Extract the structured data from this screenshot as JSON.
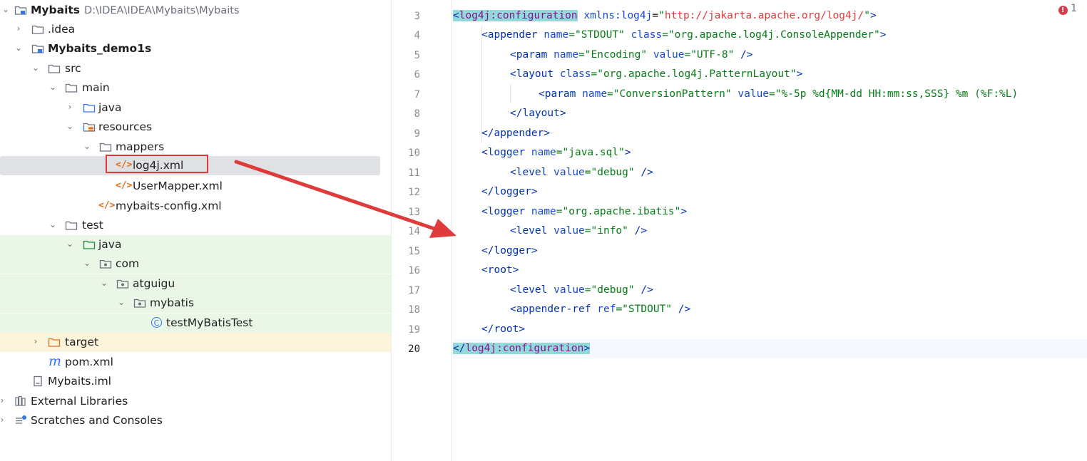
{
  "tree": {
    "project": {
      "name": "Mybaits",
      "path": "D:\\IDEA\\IDEA\\Mybaits\\Mybaits"
    },
    "idea": ".idea",
    "module": "Mybaits_demo1s",
    "src": "src",
    "main": "main",
    "main_java": "java",
    "resources": "resources",
    "mappers": "mappers",
    "log4j": "log4j.xml",
    "usermapper": "UserMapper.xml",
    "mybatis_config": "mybaits-config.xml",
    "test": "test",
    "test_java": "java",
    "com": "com",
    "atguigu": "atguigu",
    "mybatis": "mybatis",
    "test_class": "testMyBatisTest",
    "target": "target",
    "pom": "pom.xml",
    "iml": "Mybaits.iml",
    "external_libraries": "External Libraries",
    "scratches": "Scratches and Consoles"
  },
  "icons": {
    "code_glyph": "</>",
    "maven_glyph": "m",
    "class_glyph": "C",
    "chevron_right": "›",
    "chevron_down": "⌄"
  },
  "editor": {
    "problems_count": "1",
    "error_glyph": "!",
    "lines": [
      "3",
      "4",
      "5",
      "6",
      "7",
      "8",
      "9",
      "10",
      "11",
      "12",
      "13",
      "14",
      "15",
      "16",
      "17",
      "18",
      "19",
      "20"
    ],
    "code": {
      "l3": {
        "open": "<",
        "tag": "log4j:configuration",
        "attr": "xmlns:log4j",
        "eq": "=",
        "q1": "\"",
        "url": "http://jakarta.apache.org/log4j/",
        "q2": "\"",
        "close": ">"
      },
      "l4": {
        "open": "<",
        "tag": "appender",
        "a1": "name",
        "v1": "=\"STDOUT\"",
        "a2": "class",
        "v2": "=\"org.apache.log4j.ConsoleAppender\"",
        "close": ">"
      },
      "l5": {
        "open": "<",
        "tag": "param",
        "a1": "name",
        "v1": "=\"Encoding\"",
        "a2": "value",
        "v2": "=\"UTF-8\"",
        "close": " />"
      },
      "l6": {
        "open": "<",
        "tag": "layout",
        "a1": "class",
        "v1": "=\"org.apache.log4j.PatternLayout\"",
        "close": ">"
      },
      "l7": {
        "open": "<",
        "tag": "param",
        "a1": "name",
        "v1": "=\"ConversionPattern\"",
        "a2": "value",
        "v2": "=\"%-5p %d{MM-dd HH:mm:ss,SSS} %m (%F:%L)"
      },
      "l8": {
        "open": "</",
        "tag": "layout",
        "close": ">"
      },
      "l9": {
        "open": "</",
        "tag": "appender",
        "close": ">"
      },
      "l10": {
        "open": "<",
        "tag": "logger",
        "a1": "name",
        "v1": "=\"java.sql\"",
        "close": ">"
      },
      "l11": {
        "open": "<",
        "tag": "level",
        "a1": "value",
        "v1": "=\"debug\"",
        "close": " />"
      },
      "l12": {
        "open": "</",
        "tag": "logger",
        "close": ">"
      },
      "l13": {
        "open": "<",
        "tag": "logger",
        "a1": "name",
        "v1": "=\"org.apache.ibatis\"",
        "close": ">"
      },
      "l14": {
        "open": "<",
        "tag": "level",
        "a1": "value",
        "v1": "=\"info\"",
        "close": " />"
      },
      "l15": {
        "open": "</",
        "tag": "logger",
        "close": ">"
      },
      "l16": {
        "open": "<",
        "tag": "root",
        "close": ">"
      },
      "l17": {
        "open": "<",
        "tag": "level",
        "a1": "value",
        "v1": "=\"debug\"",
        "close": " />"
      },
      "l18": {
        "open": "<",
        "tag": "appender-ref",
        "a1": "ref",
        "v1": "=\"STDOUT\"",
        "close": " />"
      },
      "l19": {
        "open": "</",
        "tag": "root",
        "close": ">"
      },
      "l20": {
        "open": "</",
        "tag": "log4j:configuration",
        "close": ">"
      }
    }
  },
  "colors": {
    "annotation": "#e03b3b",
    "selection": "#dfe1e5",
    "test_bg": "#eaf7e7",
    "excluded_bg": "#fcf5dc",
    "tag_highlight": "#93d9d9"
  }
}
